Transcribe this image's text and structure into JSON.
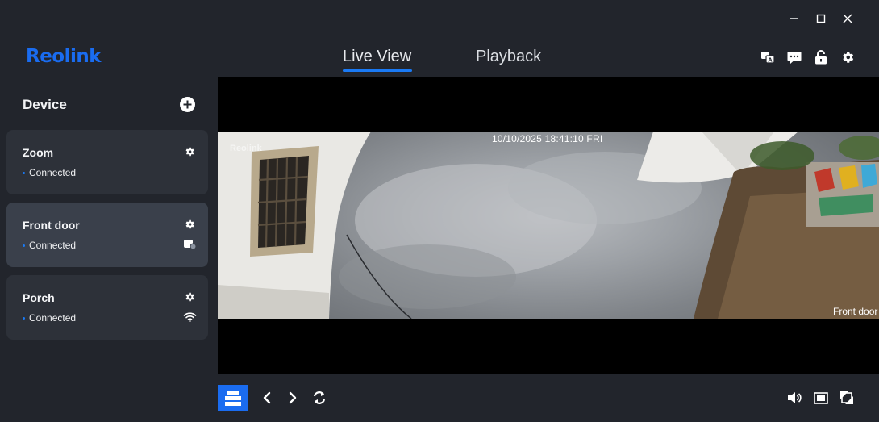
{
  "app": {
    "logo_text": "Reolink",
    "accent_color": "#1a6cf0"
  },
  "window_controls": [
    {
      "name": "minimize",
      "icon": "minimize-icon"
    },
    {
      "name": "maximize",
      "icon": "maximize-icon"
    },
    {
      "name": "close",
      "icon": "close-icon"
    }
  ],
  "header": {
    "tabs": [
      {
        "label": "Live View",
        "active": true
      },
      {
        "label": "Playback",
        "active": false
      }
    ],
    "icons": [
      "translate-icon",
      "message-icon",
      "unlock-icon",
      "gear-icon"
    ]
  },
  "sidebar": {
    "title": "Device",
    "add_icon": "plus-circle-icon",
    "devices": [
      {
        "name": "Zoom",
        "status": "Connected",
        "badge": null,
        "selected": false
      },
      {
        "name": "Front door",
        "status": "Connected",
        "badge": "battery-camera-icon",
        "selected": true
      },
      {
        "name": "Porch",
        "status": "Connected",
        "badge": "wifi-icon",
        "selected": false
      }
    ]
  },
  "video": {
    "timestamp": "10/10/2025 18:41:10 FRI",
    "camera_label": "Front door",
    "watermark": "Reolink"
  },
  "toolbar": {
    "left_icons": [
      "layout-icon",
      "chevron-left-icon",
      "chevron-right-icon",
      "cycle-icon"
    ],
    "right_icons": [
      "speaker-icon",
      "screen-icon",
      "fullscreen-icon"
    ]
  }
}
